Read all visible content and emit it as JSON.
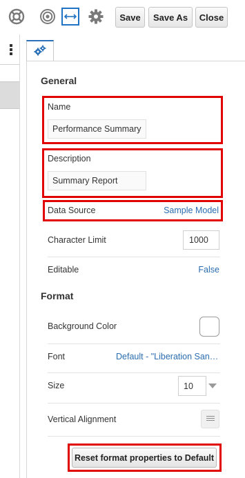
{
  "toolbar": {
    "icons": [
      "lifebuoy-icon",
      "target-icon",
      "fit-width-icon",
      "gear-icon"
    ],
    "save_label": "Save",
    "save_as_label": "Save As",
    "close_label": "Close"
  },
  "tab": {
    "icon": "gears-icon",
    "active": true
  },
  "general": {
    "title": "General",
    "name_label": "Name",
    "name_value": "Performance Summary",
    "description_label": "Description",
    "description_value": "Summary Report",
    "data_source_label": "Data Source",
    "data_source_value": "Sample Model",
    "char_limit_label": "Character Limit",
    "char_limit_value": "1000",
    "editable_label": "Editable",
    "editable_value": "False"
  },
  "format": {
    "title": "Format",
    "bg_color_label": "Background Color",
    "bg_color_value": "#ffffff",
    "font_label": "Font",
    "font_value": "Default - \"Liberation San…",
    "size_label": "Size",
    "size_value": "10",
    "valign_label": "Vertical Alignment",
    "reset_label": "Reset format properties to Default"
  },
  "colors": {
    "highlight": "#e00000",
    "link": "#2a6cb0",
    "tab_accent": "#2a70b8"
  }
}
